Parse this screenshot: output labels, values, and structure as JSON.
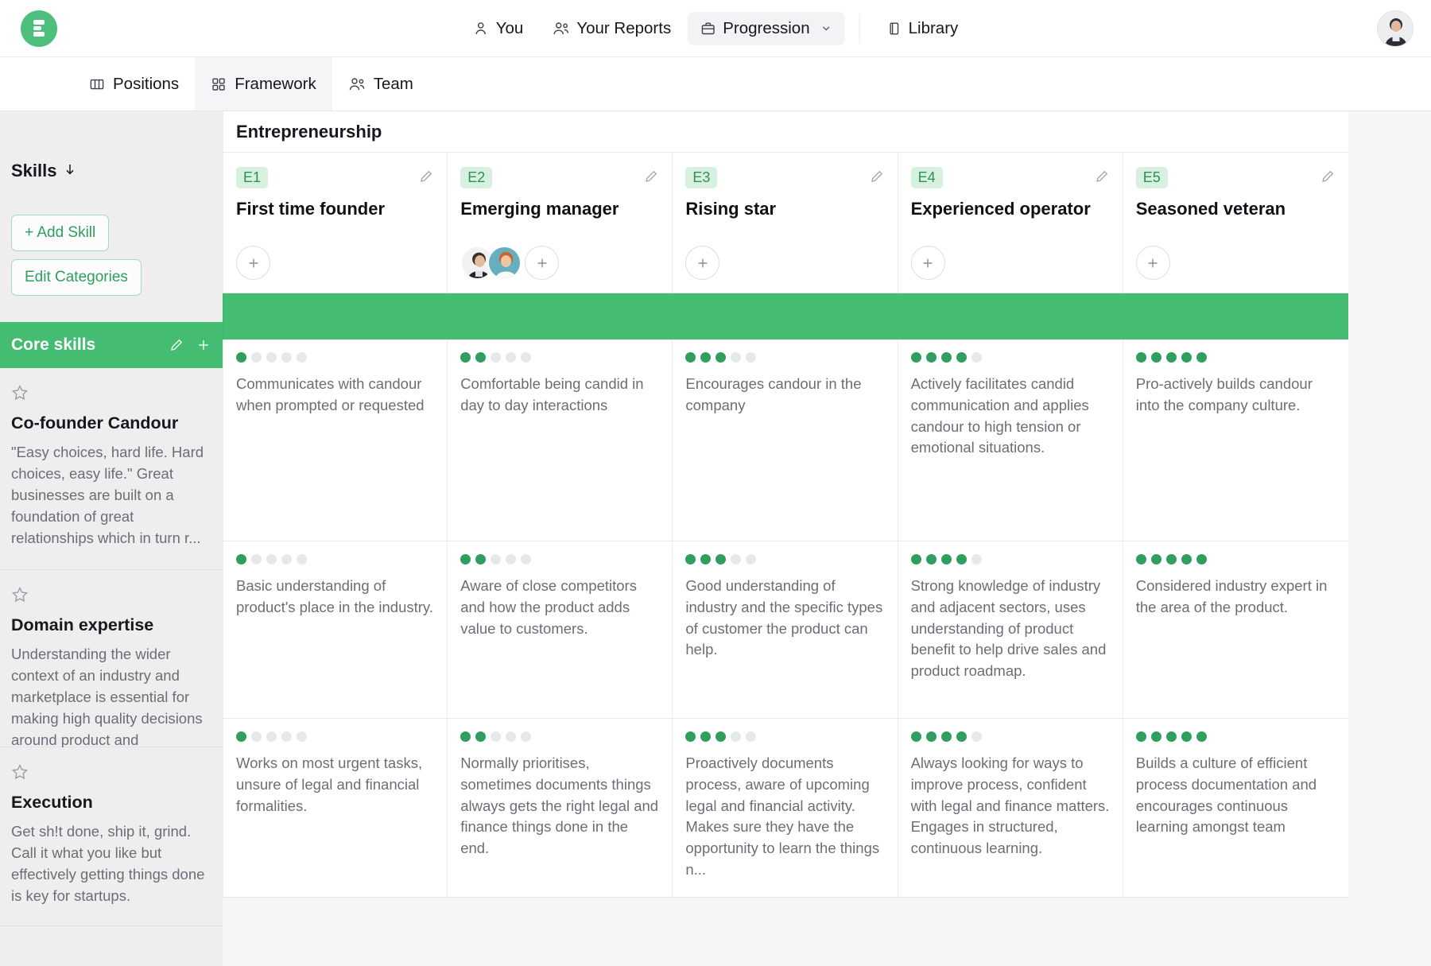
{
  "topnav": {
    "logo_icon": "progression-logo-icon",
    "items": [
      {
        "label": "You",
        "icon": "user-icon",
        "active": false
      },
      {
        "label": "Your Reports",
        "icon": "users-icon",
        "active": false
      },
      {
        "label": "Progression",
        "icon": "briefcase-icon",
        "active": true,
        "caret": "chevron-down-icon"
      },
      {
        "label": "Library",
        "icon": "book-icon",
        "active": false
      }
    ],
    "avatar": "user-avatar"
  },
  "subnav": {
    "tabs": [
      {
        "label": "Positions",
        "icon": "columns-icon",
        "active": false
      },
      {
        "label": "Framework",
        "icon": "grid-icon",
        "active": true
      },
      {
        "label": "Team",
        "icon": "team-icon",
        "active": false
      }
    ]
  },
  "rail": {
    "title": "Skills",
    "sort_icon": "arrow-down-icon",
    "add_skill_label": "+ Add Skill",
    "edit_categories_label": "Edit Categories",
    "category": {
      "label": "Core skills",
      "edit_icon": "pencil-icon",
      "add_icon": "plus-icon"
    },
    "skills": [
      {
        "star_icon": "star-outline-icon",
        "name": "Co-founder Candour",
        "description": "\"Easy choices, hard life. Hard choices, easy life.\" Great businesses are built on a foundation of great relationships which in turn r..."
      },
      {
        "star_icon": "star-outline-icon",
        "name": "Domain expertise",
        "description": "Understanding the wider context of an industry and marketplace is essential for making high quality decisions around product and business..."
      },
      {
        "star_icon": "star-outline-icon",
        "name": "Execution",
        "description": "Get sh!t done, ship it, grind. Call it what you like but effectively getting things done is key for startups."
      }
    ]
  },
  "board": {
    "track_title": "Entrepreneurship",
    "levels": [
      {
        "tag": "E1",
        "name": "First time founder",
        "edit_icon": "pencil-icon",
        "people": [],
        "add_person_icon": "plus-icon"
      },
      {
        "tag": "E2",
        "name": "Emerging manager",
        "edit_icon": "pencil-icon",
        "people": [
          "person-avatar-1",
          "person-avatar-2"
        ],
        "add_person_icon": "plus-icon"
      },
      {
        "tag": "E3",
        "name": "Rising star",
        "edit_icon": "pencil-icon",
        "people": [],
        "add_person_icon": "plus-icon"
      },
      {
        "tag": "E4",
        "name": "Experienced operator",
        "edit_icon": "pencil-icon",
        "people": [],
        "add_person_icon": "plus-icon"
      },
      {
        "tag": "E5",
        "name": "Seasoned veteran",
        "edit_icon": "pencil-icon",
        "people": [],
        "add_person_icon": "plus-icon"
      }
    ],
    "rows": [
      {
        "skill": "Co-founder Candour",
        "cells": [
          {
            "level": 1,
            "max": 5,
            "text": "Communicates with candour when prompted or requested"
          },
          {
            "level": 2,
            "max": 5,
            "text": "Comfortable being candid in day to day interactions"
          },
          {
            "level": 3,
            "max": 5,
            "text": "Encourages candour in the company"
          },
          {
            "level": 4,
            "max": 5,
            "text": "Actively facilitates candid communication and applies candour to high tension or emotional situations."
          },
          {
            "level": 5,
            "max": 5,
            "text": "Pro-actively builds candour into the company culture."
          }
        ]
      },
      {
        "skill": "Domain expertise",
        "cells": [
          {
            "level": 1,
            "max": 5,
            "text": "Basic understanding of product's place in the industry."
          },
          {
            "level": 2,
            "max": 5,
            "text": "Aware of close competitors and how the product adds value to customers."
          },
          {
            "level": 3,
            "max": 5,
            "text": "Good understanding of industry and the specific types of customer the product can help."
          },
          {
            "level": 4,
            "max": 5,
            "text": "Strong knowledge of industry and adjacent sectors, uses understanding of product benefit to help drive sales and product roadmap."
          },
          {
            "level": 5,
            "max": 5,
            "text": "Considered industry expert in the area of the product."
          }
        ]
      },
      {
        "skill": "Execution",
        "cells": [
          {
            "level": 1,
            "max": 5,
            "text": "Works on most urgent tasks, unsure of legal and financial formalities."
          },
          {
            "level": 2,
            "max": 5,
            "text": "Normally prioritises, sometimes documents things always gets the right legal and finance things done in the end."
          },
          {
            "level": 3,
            "max": 5,
            "text": "Proactively documents process, aware of upcoming legal and financial activity. Makes sure they have the opportunity to learn the things n..."
          },
          {
            "level": 4,
            "max": 5,
            "text": "Always looking for ways to improve process, confident with legal and finance matters. Engages in structured, continuous learning."
          },
          {
            "level": 5,
            "max": 5,
            "text": "Builds a culture of efficient process documentation and encourages continuous learning amongst team"
          }
        ]
      }
    ]
  },
  "colors": {
    "brand_green": "#44bd72",
    "dot_green": "#2f9e5f",
    "tag_bg": "#d7f0e0",
    "rail_bg": "#eeeeef"
  }
}
